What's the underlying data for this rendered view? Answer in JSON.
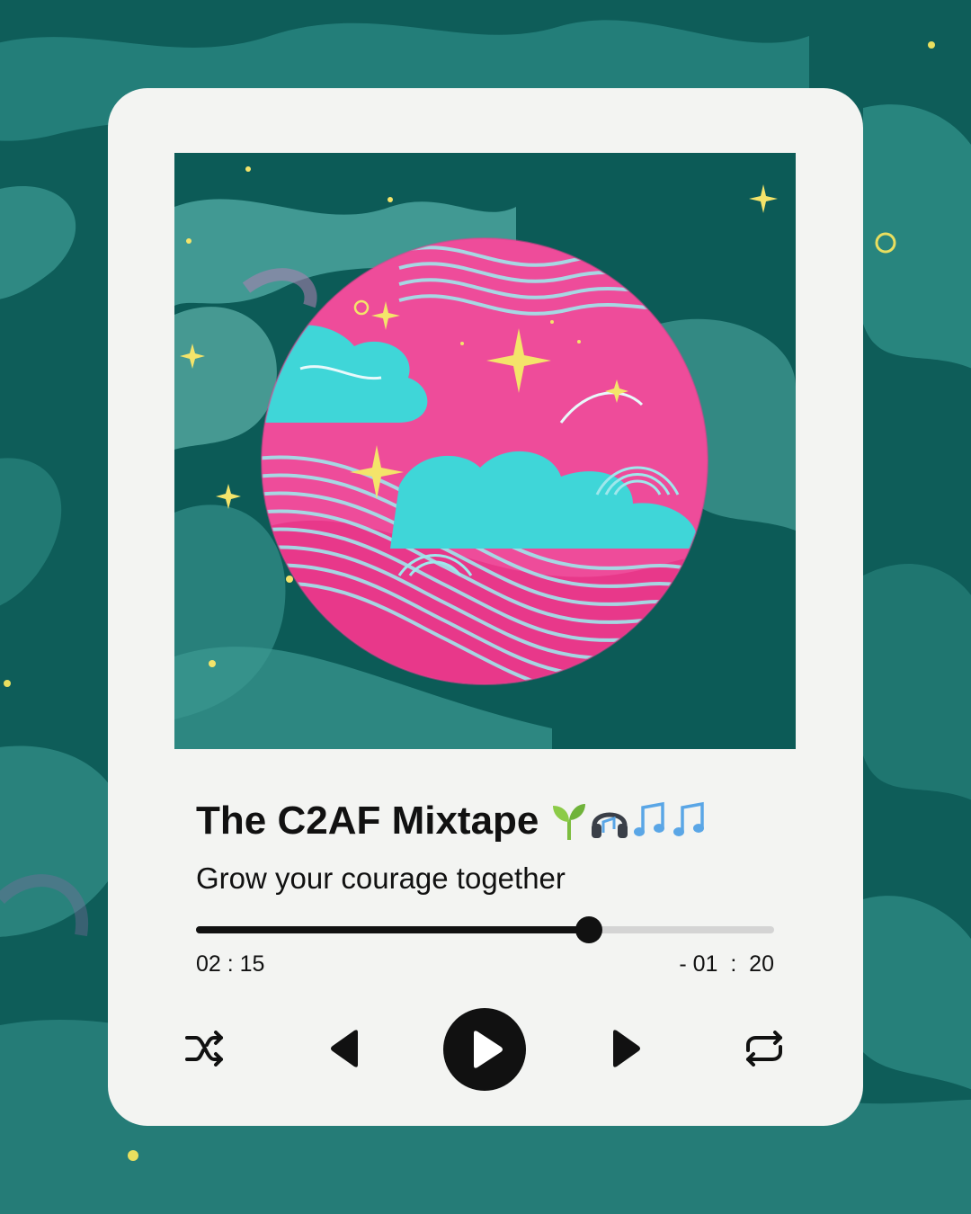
{
  "player": {
    "title": "The C2AF Mixtape",
    "title_emoji": [
      "seedling-icon",
      "headphones-icon",
      "music-notes-icon",
      "music-notes-icon"
    ],
    "subtitle": "Grow your courage together",
    "elapsed": "02 : 15",
    "remaining": "- 01  :  20",
    "progress": 0.68
  },
  "controls": [
    "shuffle-icon",
    "previous-icon",
    "play-icon",
    "next-icon",
    "repeat-icon"
  ],
  "colors": {
    "background": "#0d5a56",
    "card": "#f3f4f2",
    "planet_pink": "#ee4c9a",
    "cloud_cyan": "#3fd6d8",
    "star_yellow": "#f4e46a",
    "control_black": "#111111"
  }
}
